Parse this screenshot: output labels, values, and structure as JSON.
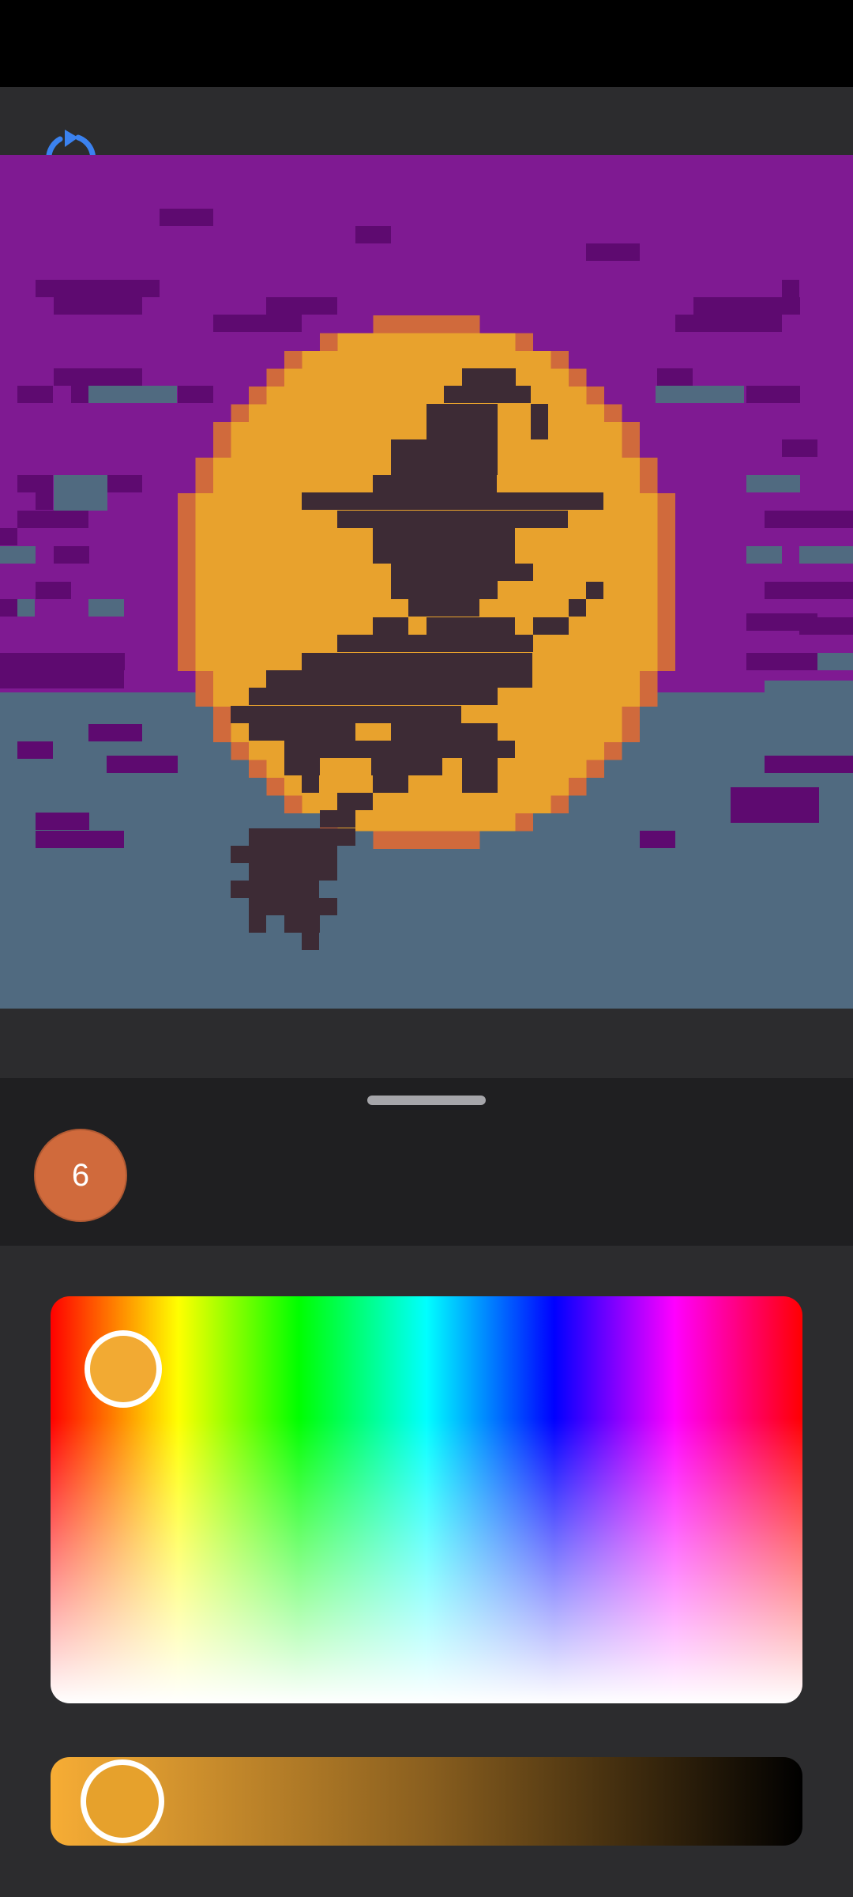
{
  "toolbar": {
    "refresh_icon": "refresh-icon"
  },
  "artwork": {
    "subject": "witch-on-broom-pixel-art",
    "colors": {
      "sky": "#7f1a92",
      "sky_dark": "#5e0a70",
      "ground": "#506a80",
      "moon": "#e8a22d",
      "moon_rim": "#d06a3c",
      "silhouette": "#3d2b35"
    }
  },
  "palette": {
    "selected_swatch": {
      "number": "6",
      "color": "#d06a3c"
    }
  },
  "color_picker": {
    "selected_color": "#f2aa33",
    "brightness_color": "#e6a12c"
  }
}
